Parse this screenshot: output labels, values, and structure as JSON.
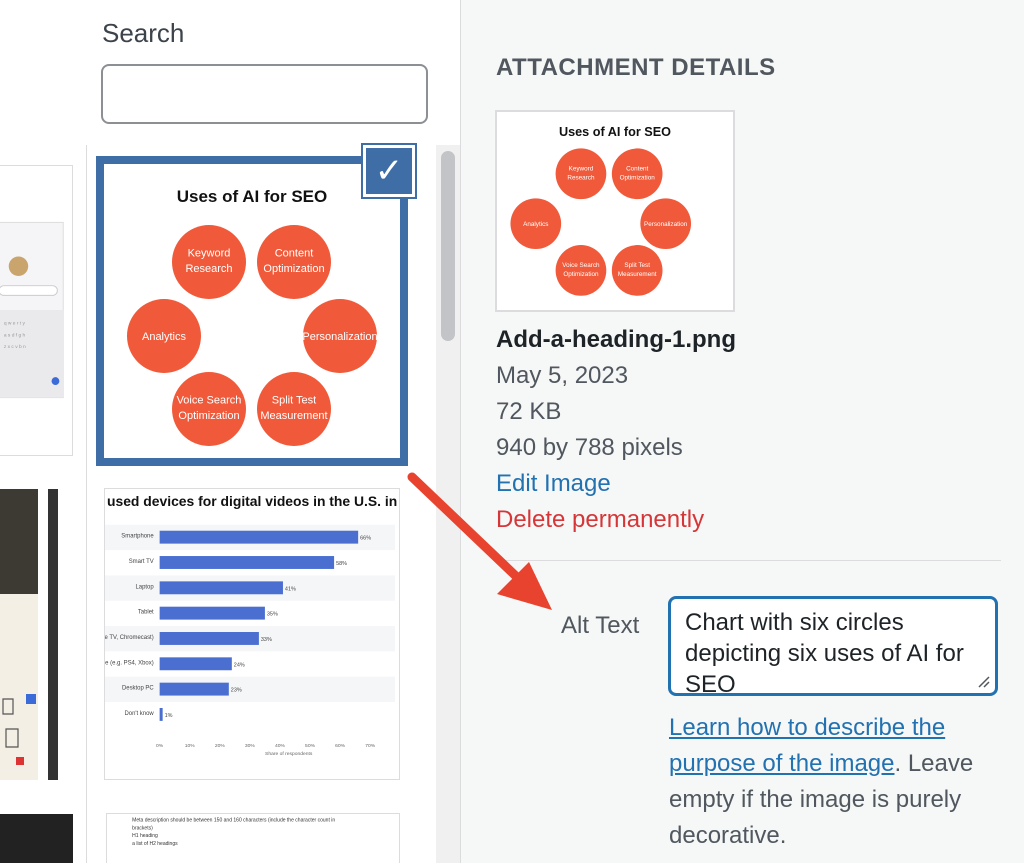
{
  "search": {
    "label": "Search",
    "value": "",
    "placeholder": ""
  },
  "selected_thumb": {
    "title": "Uses of AI for SEO",
    "circles": [
      {
        "l1": "Keyword",
        "l2": "Research"
      },
      {
        "l1": "Content",
        "l2": "Optimization"
      },
      {
        "l1": "Analytics",
        "l2": ""
      },
      {
        "l1": "Personalization",
        "l2": ""
      },
      {
        "l1": "Voice Search",
        "l2": "Optimization"
      },
      {
        "l1": "Split Test",
        "l2": "Measurement"
      }
    ]
  },
  "bar_thumb": {
    "title": "used devices for digital videos in the U.S. in",
    "rows": [
      {
        "label": "Smartphone",
        "value": "66%",
        "pct": 66
      },
      {
        "label": "Smart TV",
        "value": "58%",
        "pct": 58
      },
      {
        "label": "Laptop",
        "value": "41%",
        "pct": 41
      },
      {
        "label": "Tablet",
        "value": "35%",
        "pct": 35
      },
      {
        "label": "ce (e.g. Apple TV, Chromecast)",
        "value": "33%",
        "pct": 33
      },
      {
        "label": "e (e.g. PS4, Xbox)",
        "value": "24%",
        "pct": 24
      },
      {
        "label": "Desktop PC",
        "value": "23%",
        "pct": 23
      },
      {
        "label": "Don't know",
        "value": "1%",
        "pct": 1
      }
    ],
    "ticks": [
      "0%",
      "10%",
      "20%",
      "30%",
      "40%",
      "50%",
      "60%",
      "70%"
    ],
    "xlabel": "Share of respondents"
  },
  "text_thumb": {
    "line1": "Meta description should be between 150 and 160 characters (include the character count in",
    "line2": "brackets)",
    "line3": "H1 heading",
    "line4": "a list of H2 headings"
  },
  "details": {
    "heading": "ATTACHMENT DETAILS",
    "filename": "Add-a-heading-1.png",
    "date": "May 5, 2023",
    "size": "72 KB",
    "dimensions": "940 by 788 pixels",
    "edit_link": "Edit Image",
    "delete_link": "Delete permanently",
    "alt_label": "Alt Text",
    "alt_value": "Chart with six circles depicting six uses of AI for SEO",
    "help_link": "Learn how to describe the purpose of the image",
    "help_text": ". Leave empty if the image is purely decorative."
  },
  "colors": {
    "accent": "#2271b1",
    "selection": "#3e6ea5",
    "danger": "#d63638",
    "circle": "#f05a3a",
    "bar": "#4a6fd0",
    "arrow": "#e8432e"
  }
}
